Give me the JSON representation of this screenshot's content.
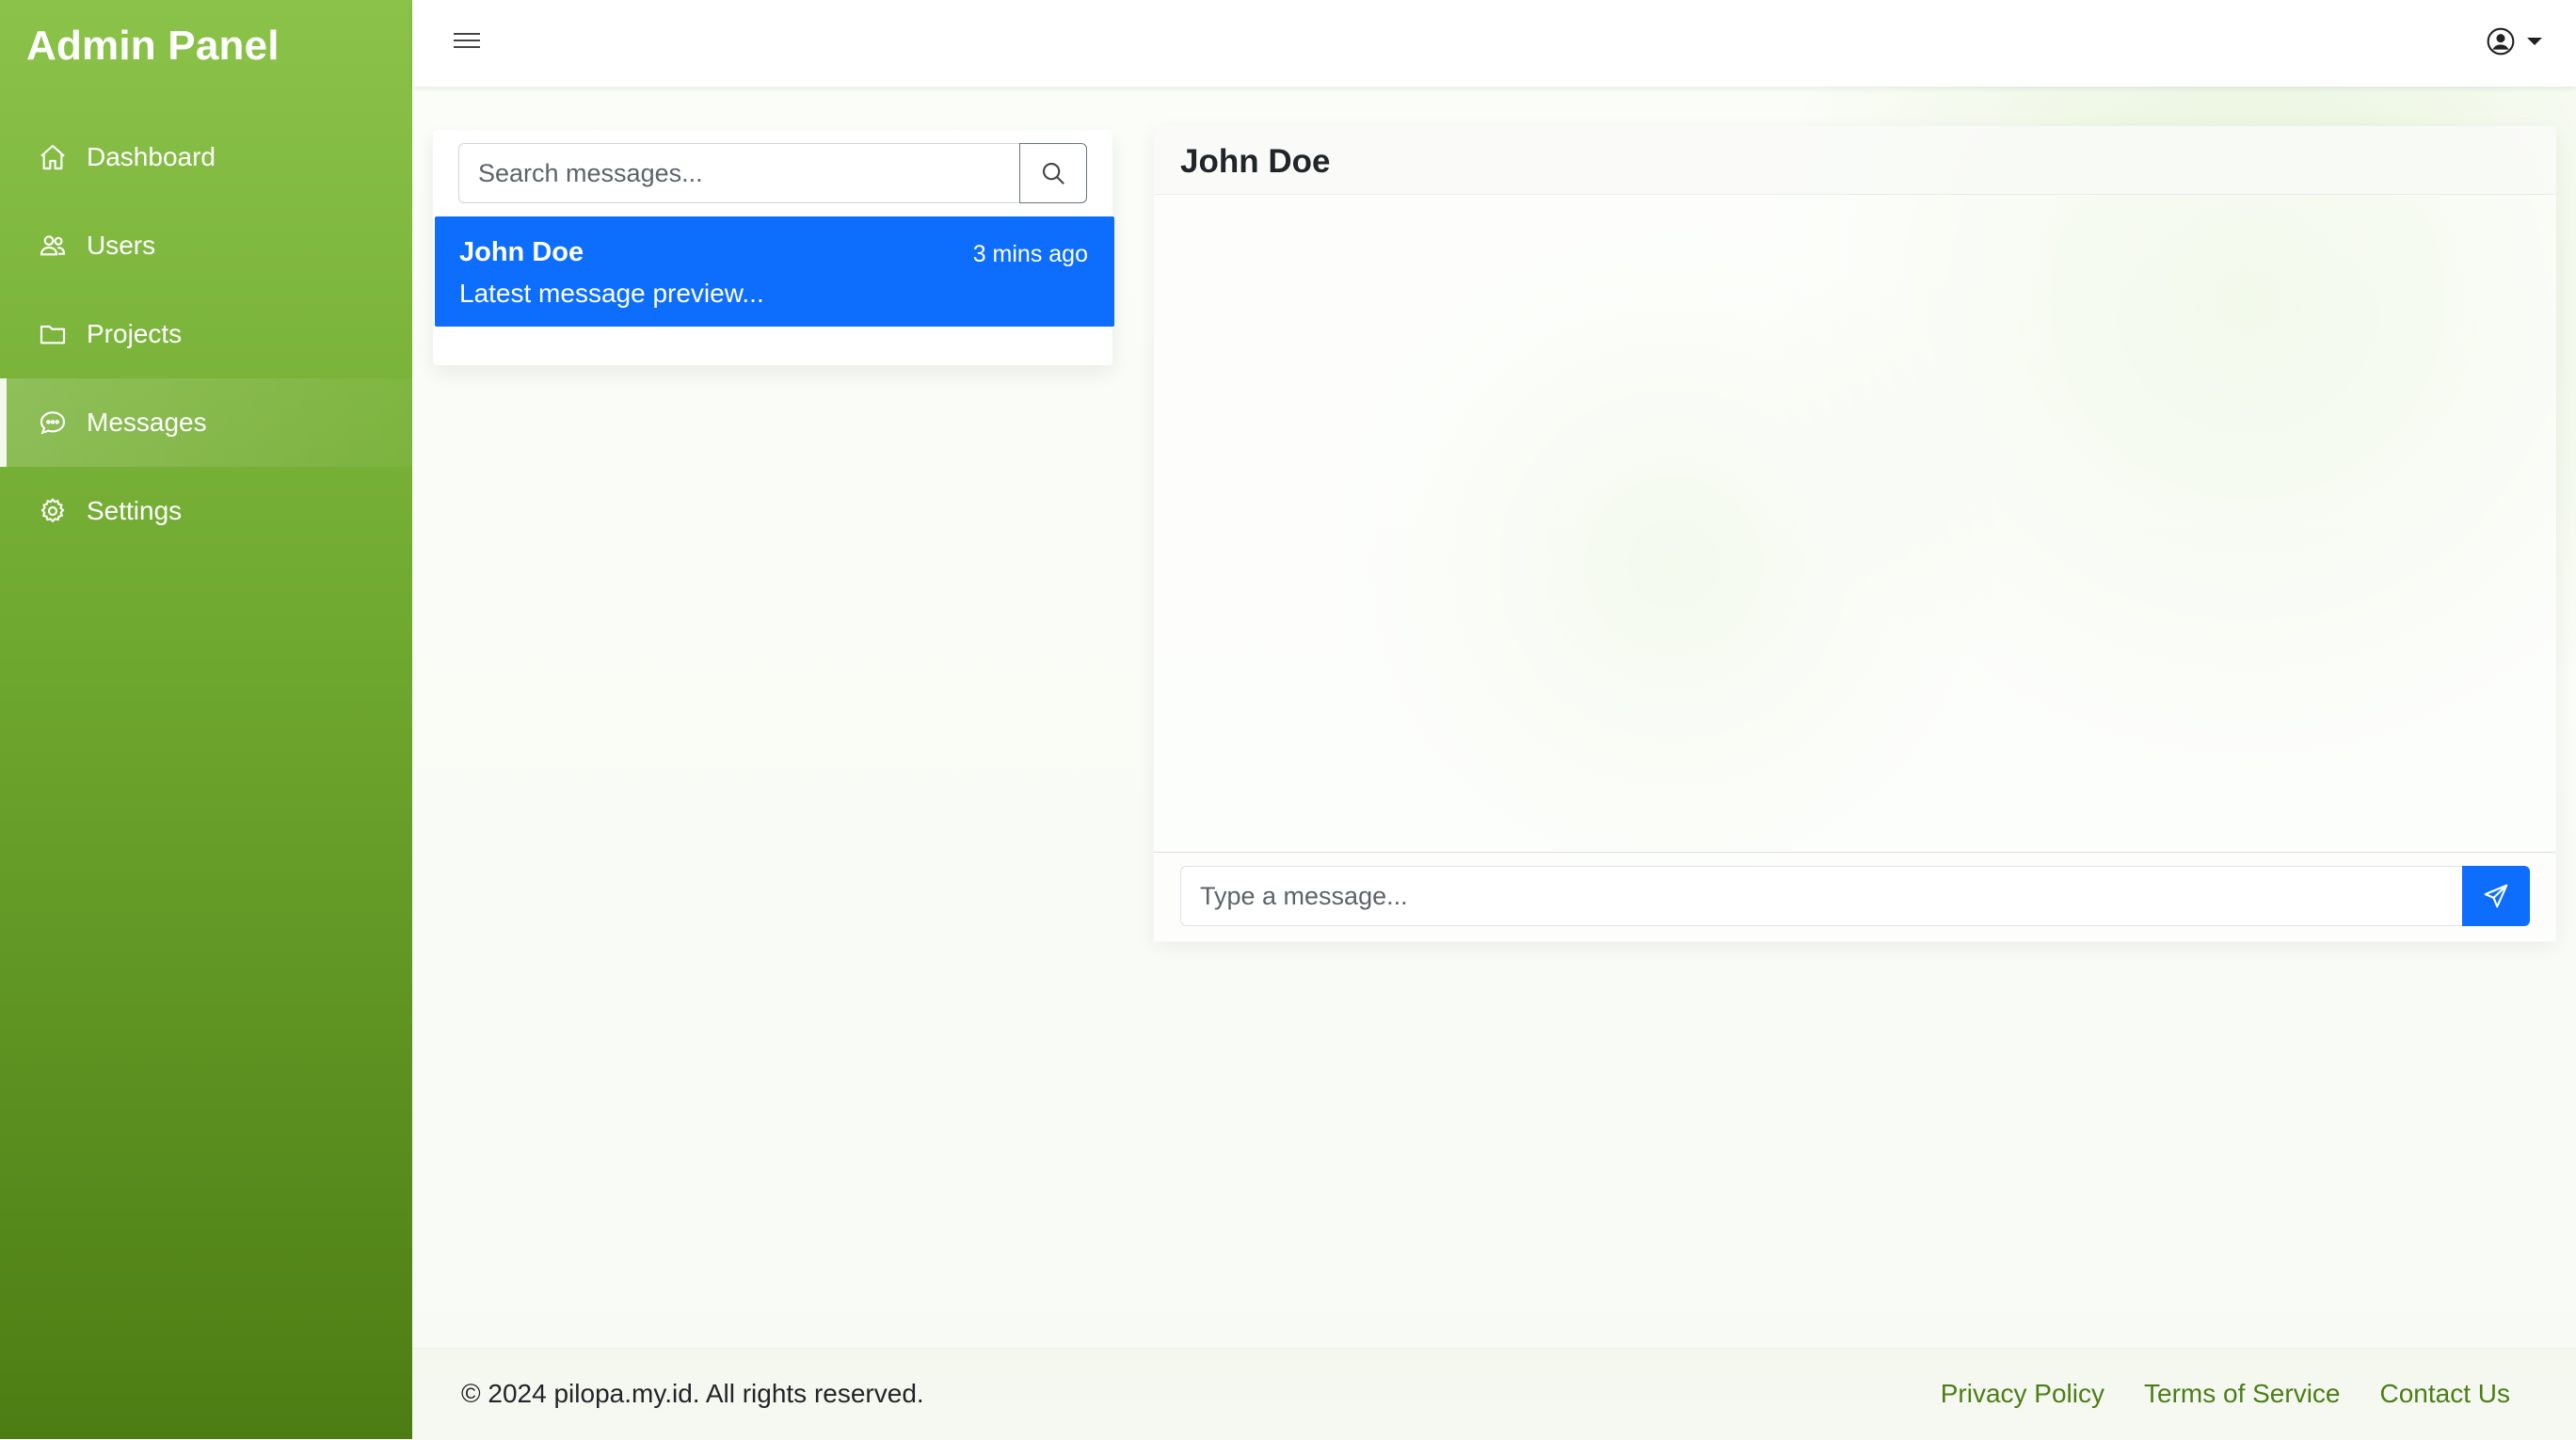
{
  "sidebar": {
    "brand": "Admin Panel",
    "items": [
      {
        "label": "Dashboard",
        "icon": "home-icon",
        "active": false
      },
      {
        "label": "Users",
        "icon": "users-icon",
        "active": false
      },
      {
        "label": "Projects",
        "icon": "folder-icon",
        "active": false
      },
      {
        "label": "Messages",
        "icon": "chat-icon",
        "active": true
      },
      {
        "label": "Settings",
        "icon": "gear-icon",
        "active": false
      }
    ]
  },
  "topbar": {
    "menu_icon": "hamburger-icon",
    "user_icon": "user-circle-icon"
  },
  "conversations": {
    "search_placeholder": "Search messages...",
    "items": [
      {
        "name": "John Doe",
        "time": "3 mins ago",
        "preview": "Latest message preview..."
      }
    ]
  },
  "chat": {
    "title": "John Doe",
    "input_placeholder": "Type a message..."
  },
  "footer": {
    "copyright": "© 2024 pilopa.my.id. All rights reserved.",
    "links": [
      "Privacy Policy",
      "Terms of Service",
      "Contact Us"
    ]
  },
  "colors": {
    "sidebar_top": "#8bc34a",
    "sidebar_bottom": "#4c7d14",
    "accent": "#0d6efd",
    "footer_link": "#4d7d17"
  }
}
